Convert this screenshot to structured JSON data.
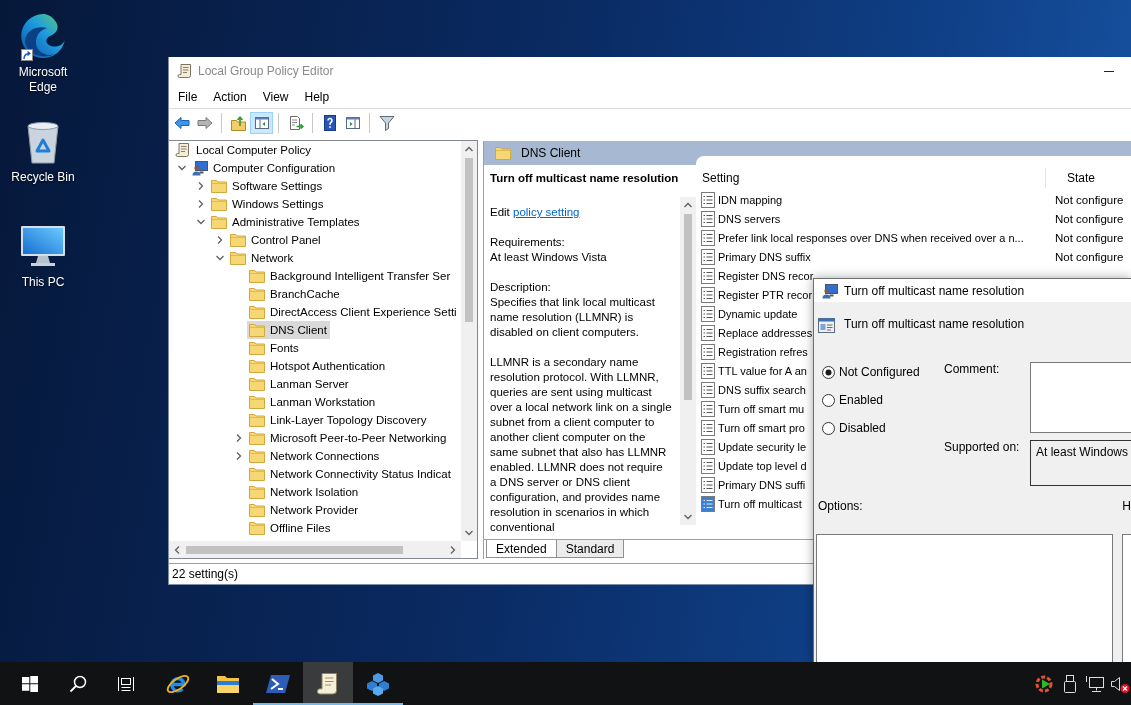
{
  "desktop_icons": [
    {
      "kind": "edge",
      "label": "Microsoft Edge",
      "shortcut": true
    },
    {
      "kind": "recycle-bin",
      "label": "Recycle Bin",
      "shortcut": false
    },
    {
      "kind": "this-pc",
      "label": "This PC",
      "shortcut": false
    }
  ],
  "window": {
    "title": "Local Group Policy Editor"
  },
  "menu": [
    "File",
    "Action",
    "View",
    "Help"
  ],
  "toolbar": [
    [
      {
        "kind": "back",
        "pressed": false,
        "disabled": false
      },
      {
        "kind": "forward",
        "pressed": false,
        "disabled": true
      }
    ],
    [
      {
        "kind": "up",
        "pressed": false,
        "disabled": false
      },
      {
        "kind": "console-tree",
        "pressed": true,
        "disabled": false
      }
    ],
    [
      {
        "kind": "export",
        "pressed": false,
        "disabled": false
      }
    ],
    [
      {
        "kind": "help",
        "pressed": false,
        "disabled": false
      },
      {
        "kind": "action-pane",
        "pressed": false,
        "disabled": false
      }
    ],
    [
      {
        "kind": "filter",
        "pressed": false,
        "disabled": false
      }
    ]
  ],
  "tree": {
    "items": [
      {
        "kind": "policy",
        "label": "Local Computer Policy",
        "selected": false,
        "children": [
          {
            "kind": "computer",
            "label": "Computer Configuration",
            "expanded": true,
            "selected": false,
            "children": [
              {
                "kind": "folder",
                "label": "Software Settings",
                "expanded": false,
                "selected": false
              },
              {
                "kind": "folder",
                "label": "Windows Settings",
                "expanded": false,
                "selected": false
              },
              {
                "kind": "folder",
                "label": "Administrative Templates",
                "expanded": true,
                "selected": false,
                "children": [
                  {
                    "kind": "folder",
                    "label": "Control Panel",
                    "expanded": false,
                    "selected": false
                  },
                  {
                    "kind": "folder",
                    "label": "Network",
                    "expanded": true,
                    "selected": false,
                    "children": [
                      {
                        "kind": "folder",
                        "label": "Background Intelligent Transfer Ser",
                        "selected": false
                      },
                      {
                        "kind": "folder",
                        "label": "BranchCache",
                        "selected": false
                      },
                      {
                        "kind": "folder",
                        "label": "DirectAccess Client Experience Setti",
                        "selected": false
                      },
                      {
                        "kind": "folder",
                        "label": "DNS Client",
                        "selected": true
                      },
                      {
                        "kind": "folder",
                        "label": "Fonts",
                        "selected": false
                      },
                      {
                        "kind": "folder",
                        "label": "Hotspot Authentication",
                        "selected": false
                      },
                      {
                        "kind": "folder",
                        "label": "Lanman Server",
                        "selected": false
                      },
                      {
                        "kind": "folder",
                        "label": "Lanman Workstation",
                        "selected": false
                      },
                      {
                        "kind": "folder",
                        "label": "Link-Layer Topology Discovery",
                        "selected": false
                      },
                      {
                        "kind": "folder",
                        "label": "Microsoft Peer-to-Peer Networking",
                        "expanded": false,
                        "selected": false
                      },
                      {
                        "kind": "folder",
                        "label": "Network Connections",
                        "expanded": false,
                        "selected": false
                      },
                      {
                        "kind": "folder",
                        "label": "Network Connectivity Status Indicat",
                        "selected": false
                      },
                      {
                        "kind": "folder",
                        "label": "Network Isolation",
                        "selected": false
                      },
                      {
                        "kind": "folder",
                        "label": "Network Provider",
                        "selected": false
                      },
                      {
                        "kind": "folder",
                        "label": "Offline Files",
                        "selected": false
                      }
                    ]
                  }
                ]
              }
            ]
          }
        ]
      }
    ]
  },
  "details": {
    "header": "DNS Client",
    "description": {
      "title": "Turn off multicast name resolution",
      "edit_prefix": "Edit",
      "edit_link": "policy setting",
      "requirements_label": "Requirements:",
      "requirements": "At least Windows Vista",
      "description_label": "Description:",
      "paragraphs": [
        "Specifies that link local multicast name resolution (LLMNR) is disabled on client computers.",
        "LLMNR is a secondary name resolution protocol. With LLMNR, queries are sent using multicast over a local network link on a single subnet from a client computer to another client computer on the same subnet that also has LLMNR enabled. LLMNR does not require a DNS server or DNS client configuration, and provides name resolution in scenarios in which conventional"
      ]
    },
    "settings": {
      "columns": [
        "Setting",
        "State"
      ],
      "rows": [
        {
          "name": "IDN mapping",
          "state": "Not configure",
          "selected": false
        },
        {
          "name": "DNS servers",
          "state": "Not configure",
          "selected": false
        },
        {
          "name": "Prefer link local responses over DNS when received over a n...",
          "state": "Not configure",
          "selected": false
        },
        {
          "name": "Primary DNS suffix",
          "state": "Not configure",
          "selected": false
        },
        {
          "name": "Register DNS recor",
          "selected": false
        },
        {
          "name": "Register PTR recor",
          "selected": false
        },
        {
          "name": "Dynamic update",
          "selected": false
        },
        {
          "name": "Replace addresses",
          "selected": false
        },
        {
          "name": "Registration refres",
          "selected": false
        },
        {
          "name": "TTL value for A an",
          "selected": false
        },
        {
          "name": "DNS suffix search",
          "selected": false
        },
        {
          "name": "Turn off smart mu",
          "selected": false
        },
        {
          "name": "Turn off smart pro",
          "selected": false
        },
        {
          "name": "Update security le",
          "selected": false
        },
        {
          "name": "Update top level d",
          "selected": false
        },
        {
          "name": "Primary DNS suffi",
          "selected": false
        },
        {
          "name": "Turn off multicast",
          "selected": true
        }
      ]
    },
    "tabs": [
      {
        "label": "Extended",
        "selected": true
      },
      {
        "label": "Standard",
        "selected": false
      }
    ]
  },
  "status_bar": "22 setting(s)",
  "dialog": {
    "title": "Turn off multicast name resolution",
    "heading": "Turn off multicast name resolution",
    "options": [
      {
        "label": "Not Configured",
        "selected": true
      },
      {
        "label": "Enabled",
        "selected": false
      },
      {
        "label": "Disabled",
        "selected": false
      }
    ],
    "comment_label": "Comment:",
    "supported_label": "Supported on:",
    "supported_value": "At least Windows",
    "options_label": "Options:",
    "help_label": "H"
  },
  "taskbar": {
    "items": [
      {
        "kind": "start",
        "running": false,
        "active": false
      },
      {
        "kind": "search",
        "running": false,
        "active": false
      },
      {
        "kind": "task-view",
        "running": false,
        "active": false
      },
      {
        "kind": "ie",
        "running": false,
        "active": false
      },
      {
        "kind": "explorer",
        "running": false,
        "active": false
      },
      {
        "kind": "powershell",
        "running": true,
        "active": false
      },
      {
        "kind": "policy-editor",
        "running": true,
        "active": true
      },
      {
        "kind": "cubes",
        "running": true,
        "active": false
      }
    ],
    "tray": [
      {
        "kind": "app-status"
      },
      {
        "kind": "usb"
      },
      {
        "kind": "network"
      },
      {
        "kind": "volume",
        "muted": true
      }
    ]
  }
}
